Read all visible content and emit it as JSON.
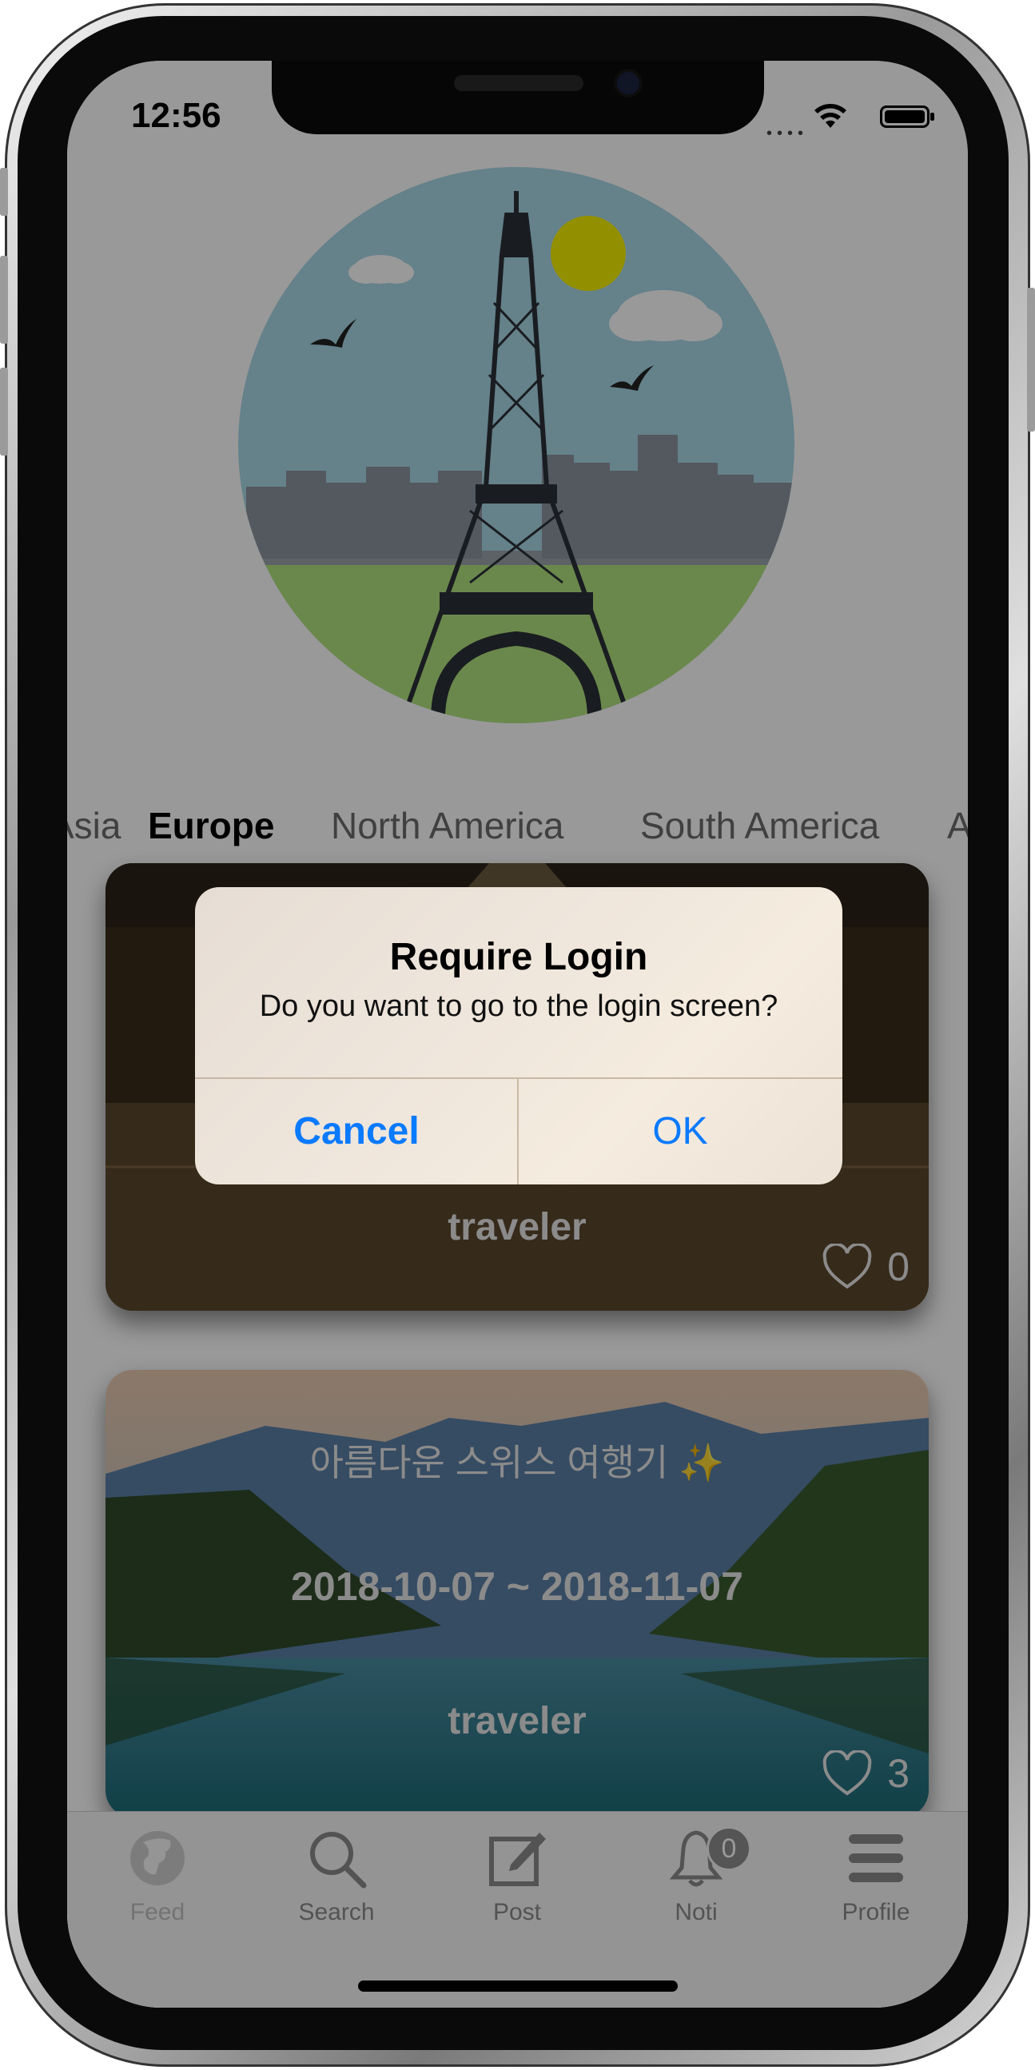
{
  "status": {
    "time": "12:56"
  },
  "tabs": {
    "items": [
      {
        "label": "Asia",
        "active": false
      },
      {
        "label": "Europe",
        "active": true
      },
      {
        "label": "North America",
        "active": false
      },
      {
        "label": "South America",
        "active": false
      },
      {
        "label": "Africa",
        "active": false
      }
    ]
  },
  "cards": [
    {
      "title": "",
      "date": "",
      "author": "traveler",
      "likes": "0"
    },
    {
      "title": "아름다운 스위스 여행기 ✨",
      "date": "2018-10-07 ~ 2018-11-07",
      "author": "traveler",
      "likes": "3"
    }
  ],
  "tabbar": {
    "feed": "Feed",
    "search": "Search",
    "post": "Post",
    "noti": "Noti",
    "noti_badge": "0",
    "profile": "Profile"
  },
  "alert": {
    "title": "Require Login",
    "message": "Do you want to go to the login screen?",
    "cancel": "Cancel",
    "ok": "OK"
  },
  "colors": {
    "accent": "#3fbf6f",
    "alert_button": "#0a7aff"
  }
}
